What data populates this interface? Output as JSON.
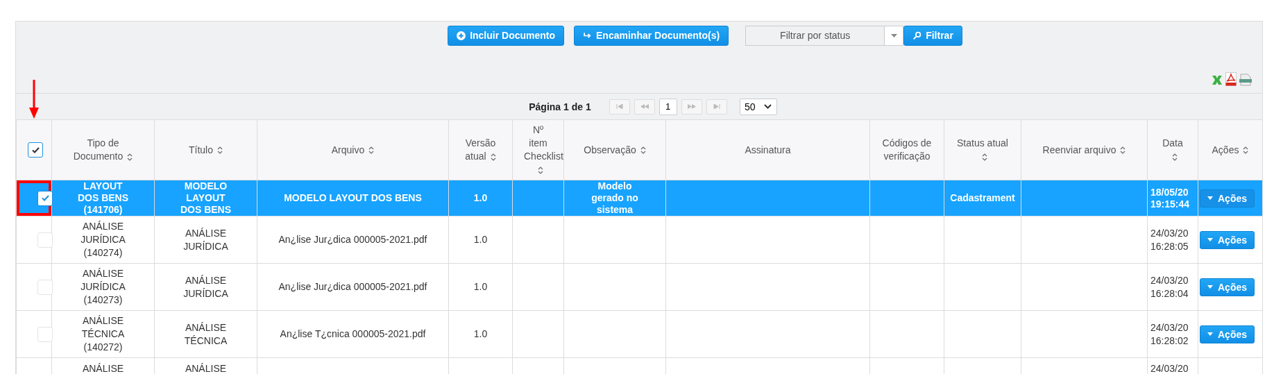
{
  "toolbar": {
    "buttons": [
      {
        "label": "Incluir Documento",
        "kind": "add"
      },
      {
        "label": "Encaminhar Documento(s)",
        "kind": "forward"
      }
    ],
    "status_filter": {
      "placeholder": "Filtrar por status"
    },
    "filter_button": {
      "label": "Filtrar"
    }
  },
  "pager": {
    "page_info": "Página 1 de 1",
    "current_page": "1",
    "page_size": "50"
  },
  "table": {
    "all_checked": true,
    "columns": [
      {
        "label": "Tipo de Documento",
        "sortable": true
      },
      {
        "label": "Título",
        "sortable": true
      },
      {
        "label": "Arquivo",
        "sortable": true
      },
      {
        "label": "Versão atual",
        "sortable": true
      },
      {
        "label": "Nº item Checklist",
        "sortable": true
      },
      {
        "label": "Observação",
        "sortable": true
      },
      {
        "label": "Assinatura",
        "sortable": false
      },
      {
        "label": "Códigos de verificação",
        "sortable": false
      },
      {
        "label": "Status atual",
        "sortable": true
      },
      {
        "label": "Reenviar arquivo",
        "sortable": true
      },
      {
        "label": "Data",
        "sortable": true
      },
      {
        "label": "Ações",
        "sortable": true
      }
    ],
    "rows": [
      {
        "selected": true,
        "partial": false,
        "tipo": "LAYOUT DOS BENS (141706)",
        "titulo": "MODELO LAYOUT DOS BENS",
        "arquivo": "MODELO LAYOUT DOS BENS",
        "versao": "1.0",
        "observacao": "Modelo gerado no sistema",
        "status": "Cadastrament",
        "date": "18/05/20",
        "time": "19:15:44",
        "action": "Ações"
      },
      {
        "selected": false,
        "partial": false,
        "tipo": "ANÁLISE JURÍDICA (140274)",
        "titulo": "ANÁLISE JURÍDICA",
        "arquivo": "An¿lise Jur¿dica 000005-2021.pdf",
        "versao": "1.0",
        "date": "24/03/20",
        "time": "16:28:05",
        "action": "Ações"
      },
      {
        "selected": false,
        "partial": false,
        "tipo": "ANÁLISE JURÍDICA (140273)",
        "titulo": "ANÁLISE JURÍDICA",
        "arquivo": "An¿lise Jur¿dica 000005-2021.pdf",
        "versao": "1.0",
        "date": "24/03/20",
        "time": "16:28:04",
        "action": "Ações"
      },
      {
        "selected": false,
        "partial": false,
        "tipo": "ANÁLISE TÉCNICA (140272)",
        "titulo": "ANÁLISE TÉCNICA",
        "arquivo": "An¿lise T¿cnica 000005-2021.pdf",
        "versao": "1.0",
        "date": "24/03/20",
        "time": "16:28:02",
        "action": "Ações"
      },
      {
        "selected": false,
        "partial": true,
        "tipo": "ANÁLISE",
        "titulo": "ANÁLISE",
        "date": "24/03/20"
      }
    ]
  }
}
